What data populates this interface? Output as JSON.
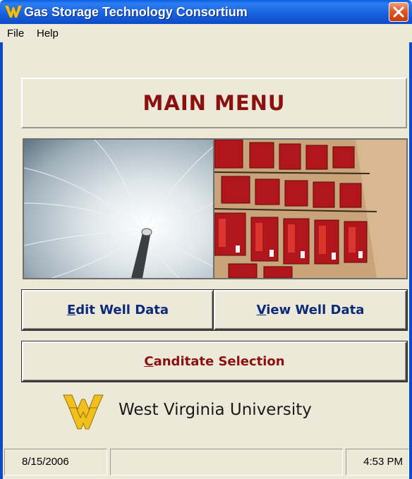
{
  "window": {
    "title": "Gas Storage Technology Consortium",
    "title_color": "#ffffff",
    "titlebar_color": "#0b4bc8"
  },
  "menu": {
    "items": [
      {
        "label": "File",
        "mnemonic": "F"
      },
      {
        "label": "Help",
        "mnemonic": "H"
      }
    ]
  },
  "main": {
    "title": "MAIN MENU",
    "title_color": "#8b1010",
    "images": [
      {
        "icon": "pipeline-interior-photo"
      },
      {
        "icon": "gas-storage-equipment-aerial-photo"
      }
    ]
  },
  "buttons": {
    "edit": {
      "prefix": "",
      "mnemonic": "E",
      "rest": "dit Well Data"
    },
    "view": {
      "prefix": "",
      "mnemonic": "V",
      "rest": "iew Well Data"
    },
    "candidate": {
      "prefix": "",
      "mnemonic": "C",
      "rest": "anditate Selection"
    }
  },
  "footer": {
    "university": "West Virginia University",
    "logo_icon": "wvu-flying-wv-logo",
    "logo_color": "#f2c01e"
  },
  "status": {
    "date": "8/15/2006",
    "middle": "",
    "time": "4:53 PM"
  }
}
